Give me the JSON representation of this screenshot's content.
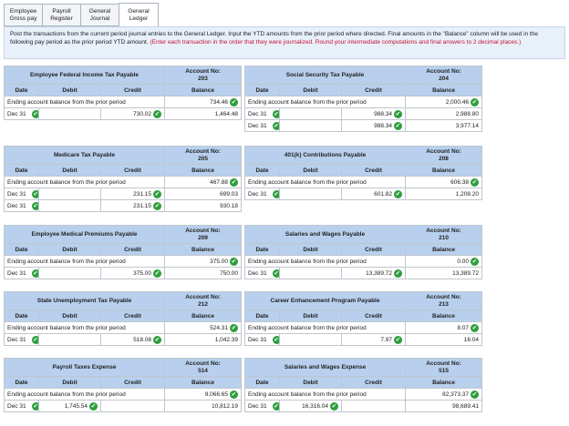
{
  "tabs": [
    {
      "label": "Employee Gross pay"
    },
    {
      "label": "Payroll Register"
    },
    {
      "label": "General Journal"
    },
    {
      "label": "General Ledger"
    }
  ],
  "instructions": {
    "text": "Post the transactions from the current period journal entries to the General Ledger. Input the YTD amounts from the prior period where directed. Final amounts in the \"Balance\" column will be used in the following pay period as the prior period YTD amount. ",
    "note": "(Enter each transaction in the order that they were journalized. Round your intermediate computations and final answers to 2 decimal places.)"
  },
  "headers": {
    "date": "Date",
    "debit": "Debit",
    "credit": "Credit",
    "balance": "Balance"
  },
  "prior_label": "Ending account balance from the prior period",
  "ledgers": [
    {
      "title": "Employee Federal Income Tax Payable",
      "acct_label": "Account No:",
      "acct_no": "203",
      "prior_balance": "734.46",
      "rows": [
        {
          "date": "Dec 31",
          "debit": "",
          "credit": "730.02",
          "balance": "1,464.48"
        }
      ]
    },
    {
      "title": "Social Security Tax Payable",
      "acct_label": "Account No:",
      "acct_no": "204",
      "prior_balance": "2,000.46",
      "rows": [
        {
          "date": "Dec 31",
          "debit": "",
          "credit": "988.34",
          "balance": "2,988.80"
        },
        {
          "date": "Dec 31",
          "debit": "",
          "credit": "988.34",
          "balance": "3,977.14"
        }
      ]
    },
    {
      "title": "Medicare Tax Payable",
      "acct_label": "Account No:",
      "acct_no": "205",
      "prior_balance": "467.88",
      "rows": [
        {
          "date": "Dec 31",
          "debit": "",
          "credit": "231.15",
          "balance": "699.03"
        },
        {
          "date": "Dec 31",
          "debit": "",
          "credit": "231.15",
          "balance": "930.18"
        }
      ]
    },
    {
      "title": "401(k) Contributions Payable",
      "acct_label": "Account No:",
      "acct_no": "208",
      "prior_balance": "606.38",
      "rows": [
        {
          "date": "Dec 31",
          "debit": "",
          "credit": "601.82",
          "balance": "1,208.20"
        }
      ]
    },
    {
      "title": "Employee Medical Premiums Payable",
      "acct_label": "Account No:",
      "acct_no": "209",
      "prior_balance": "375.00",
      "rows": [
        {
          "date": "Dec 31",
          "debit": "",
          "credit": "375.00",
          "balance": "750.00"
        }
      ]
    },
    {
      "title": "Salaries and Wages Payable",
      "acct_label": "Account No:",
      "acct_no": "210",
      "prior_balance": "0.00",
      "rows": [
        {
          "date": "Dec 31",
          "debit": "",
          "credit": "13,389.72",
          "balance": "13,389.72"
        }
      ]
    },
    {
      "title": "State Unemployment Tax Payable",
      "acct_label": "Account No:",
      "acct_no": "212",
      "prior_balance": "524.31",
      "rows": [
        {
          "date": "Dec 31",
          "debit": "",
          "credit": "518.08",
          "balance": "1,042.39"
        }
      ]
    },
    {
      "title": "Career Enhancement Program Payable",
      "acct_label": "Account No:",
      "acct_no": "213",
      "prior_balance": "8.07",
      "rows": [
        {
          "date": "Dec 31",
          "debit": "",
          "credit": "7.97",
          "balance": "16.04"
        }
      ]
    },
    {
      "title": "Payroll Taxes Expense",
      "acct_label": "Account No:",
      "acct_no": "514",
      "prior_balance": "9,066.65",
      "rows": [
        {
          "date": "Dec 31",
          "debit": "1,745.54",
          "credit": "",
          "balance": "10,812.19"
        }
      ]
    },
    {
      "title": "Salaries and Wages Expense",
      "acct_label": "Account No:",
      "acct_no": "515",
      "prior_balance": "82,373.37",
      "rows": [
        {
          "date": "Dec 31",
          "debit": "16,316.04",
          "credit": "",
          "balance": "98,689.41"
        }
      ]
    }
  ],
  "colors": {
    "header_bg": "#b8d0ee",
    "check": "#2e9e3e",
    "instructions_bg": "#e8f0fa",
    "note_red": "#c8102e"
  }
}
